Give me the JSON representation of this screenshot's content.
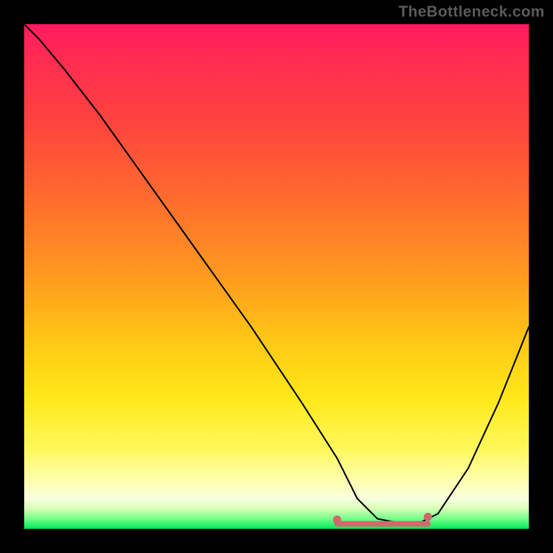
{
  "watermark": "TheBottleneck.com",
  "chart_data": {
    "type": "line",
    "title": "",
    "xlabel": "",
    "ylabel": "",
    "xlim": [
      0,
      100
    ],
    "ylim": [
      0,
      100
    ],
    "series": [
      {
        "name": "curve",
        "x": [
          0,
          3,
          8,
          15,
          25,
          35,
          45,
          55,
          62,
          66,
          70,
          75,
          78,
          82,
          88,
          94,
          100
        ],
        "y": [
          100,
          97,
          91,
          82,
          68,
          54,
          40,
          25,
          14,
          6,
          2,
          1,
          1,
          3,
          12,
          25,
          40
        ]
      }
    ],
    "highlight_range_x": [
      62,
      80
    ],
    "highlight_y": 1
  }
}
